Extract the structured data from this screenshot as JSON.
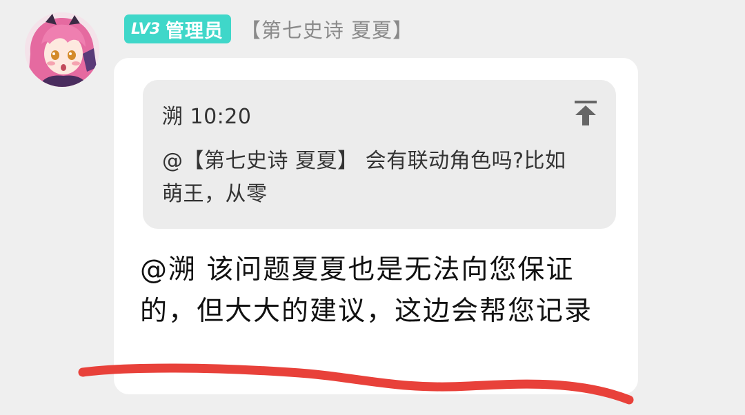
{
  "sender": {
    "badge_level": "LV3",
    "badge_role": "管理员",
    "name": "【第七史诗 夏夏】"
  },
  "quote": {
    "author": "溯",
    "time": "10:20",
    "text": "@【第七史诗 夏夏】 会有联动角色吗?比如萌王，从零"
  },
  "message": {
    "text": "@溯 该问题夏夏也是无法向您保证的，但大大的建议，这边会帮您记录"
  },
  "colors": {
    "badge": "#3fd7c9",
    "annotation": "#e8413a",
    "bubble": "#ffffff",
    "quote_bg": "#ececec"
  },
  "icons": {
    "jump": "jump-to-top-icon",
    "avatar": "anime-avatar"
  }
}
